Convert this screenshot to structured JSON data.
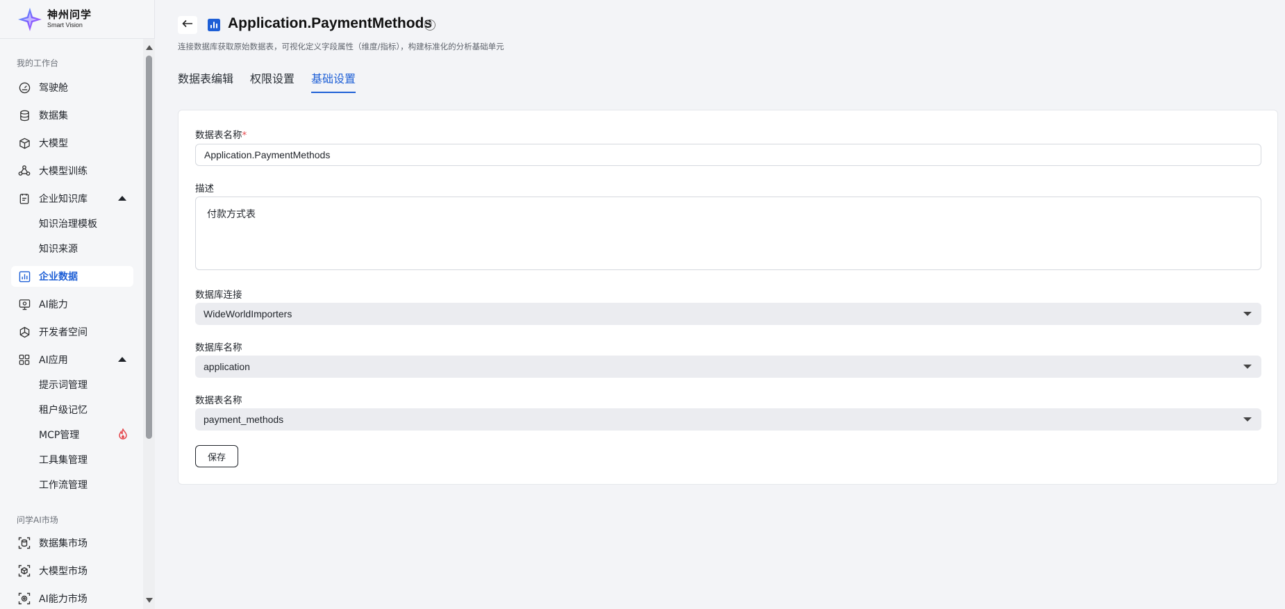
{
  "brand": {
    "name_cn": "神州问学",
    "name_en": "Smart Vision"
  },
  "sidebar": {
    "section_workbench": "我的工作台",
    "section_market": "问学AI市场",
    "items": [
      {
        "label": "驾驶舱",
        "icon": "gauge-icon"
      },
      {
        "label": "数据集",
        "icon": "database-icon"
      },
      {
        "label": "大模型",
        "icon": "cube-icon"
      },
      {
        "label": "大模型训练",
        "icon": "training-icon"
      },
      {
        "label": "企业知识库",
        "icon": "knowledge-icon"
      },
      {
        "label": "知识治理模板"
      },
      {
        "label": "知识来源"
      },
      {
        "label": "企业数据",
        "icon": "chart-icon",
        "active": true
      },
      {
        "label": "AI能力",
        "icon": "monitor-icon"
      },
      {
        "label": "开发者空间",
        "icon": "developer-icon"
      },
      {
        "label": "AI应用",
        "icon": "grid-icon"
      },
      {
        "label": "提示词管理"
      },
      {
        "label": "租户级记忆"
      },
      {
        "label": "MCP管理",
        "badge_icon": "fire-icon"
      },
      {
        "label": "工具集管理"
      },
      {
        "label": "工作流管理"
      },
      {
        "label": "数据集市场",
        "icon": "dataset-market-icon"
      },
      {
        "label": "大模型市场",
        "icon": "model-market-icon"
      },
      {
        "label": "AI能力市场",
        "icon": "ai-market-icon"
      }
    ]
  },
  "header": {
    "title": "Application.PaymentMethods",
    "subtitle": "连接数据库获取原始数据表，可视化定义字段属性（维度/指标），构建标准化的分析基础单元"
  },
  "tabs": [
    {
      "label": "数据表编辑"
    },
    {
      "label": "权限设置"
    },
    {
      "label": "基础设置",
      "active": true
    }
  ],
  "form": {
    "table_name_label": "数据表名称",
    "required_mark": "*",
    "table_name_value": "Application.PaymentMethods",
    "description_label": "描述",
    "description_value": "付款方式表",
    "db_connection_label": "数据库连接",
    "db_connection_value": "WideWorldImporters",
    "db_name_label": "数据库名称",
    "db_name_value": "application",
    "db_table_label": "数据表名称",
    "db_table_value": "payment_methods",
    "save_label": "保存"
  },
  "colors": {
    "accent": "#1e5fd6",
    "required": "#e5484d",
    "fire": "#e5484d"
  }
}
